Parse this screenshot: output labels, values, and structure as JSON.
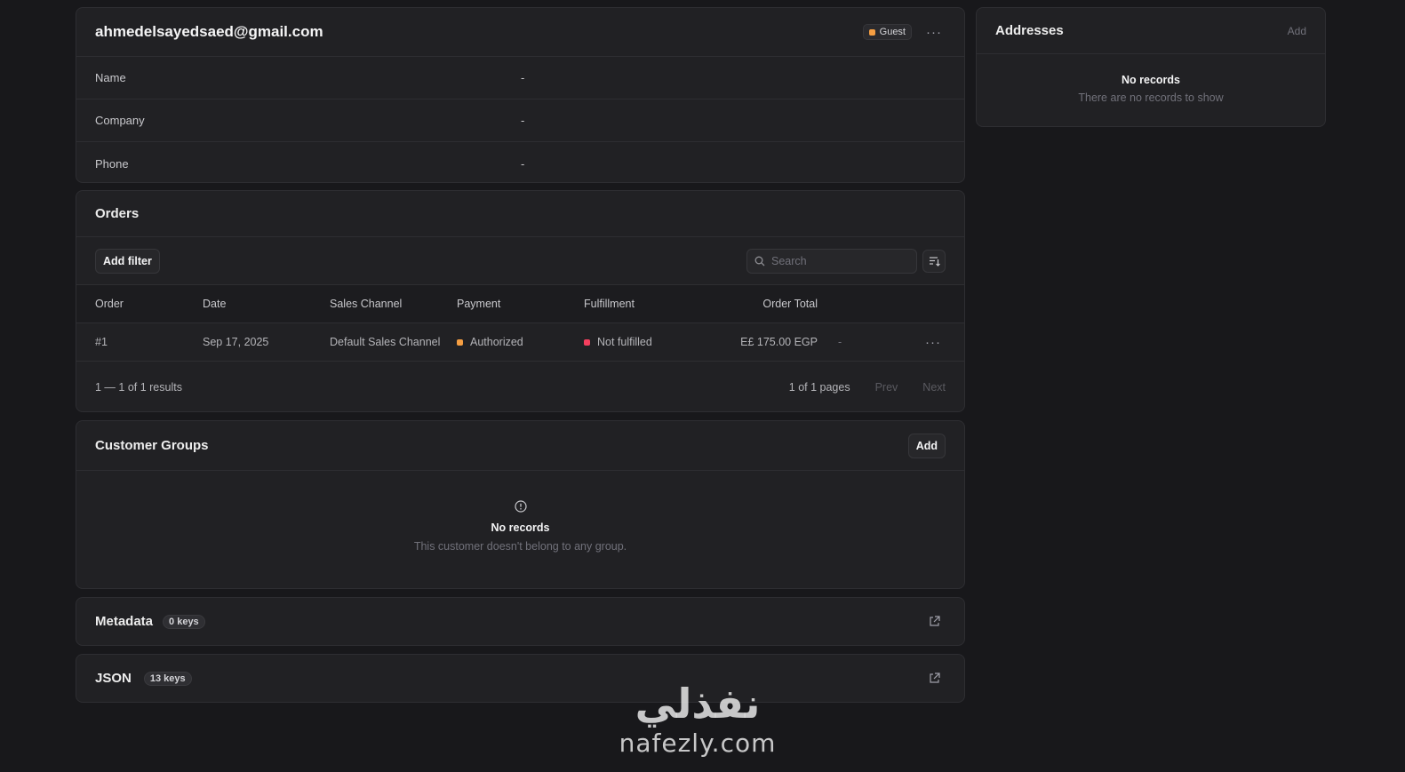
{
  "customer": {
    "email": "ahmedelsayedsaed@gmail.com",
    "status_badge": "Guest",
    "status_color": "#f59e42",
    "fields": [
      {
        "label": "Name",
        "value": "-"
      },
      {
        "label": "Company",
        "value": "-"
      },
      {
        "label": "Phone",
        "value": "-"
      }
    ]
  },
  "addresses": {
    "title": "Addresses",
    "add_label": "Add",
    "empty_title": "No records",
    "empty_text": "There are no records to show"
  },
  "orders": {
    "title": "Orders",
    "add_filter_label": "Add filter",
    "search_placeholder": "Search",
    "columns": [
      "Order",
      "Date",
      "Sales Channel",
      "Payment",
      "Fulfillment",
      "Order Total"
    ],
    "rows": [
      {
        "order": "#1",
        "date": "Sep 17, 2025",
        "sales_channel": "Default Sales Channel",
        "payment": "Authorized",
        "payment_color": "#f59e42",
        "fulfillment": "Not fulfilled",
        "fulfillment_color": "#f43f5e",
        "total": "E£ 175.00 EGP",
        "extra": "-"
      }
    ],
    "results_text": "1 — 1 of 1 results",
    "pages_text": "1 of 1 pages",
    "prev_label": "Prev",
    "next_label": "Next"
  },
  "customer_groups": {
    "title": "Customer Groups",
    "add_label": "Add",
    "empty_title": "No records",
    "empty_text": "This customer doesn't belong to any group."
  },
  "metadata": {
    "title": "Metadata",
    "keys": "0 keys"
  },
  "json": {
    "title": "JSON",
    "keys": "13 keys"
  },
  "watermark": {
    "arabic": "نفذلي",
    "latin": "nafezly.com"
  }
}
